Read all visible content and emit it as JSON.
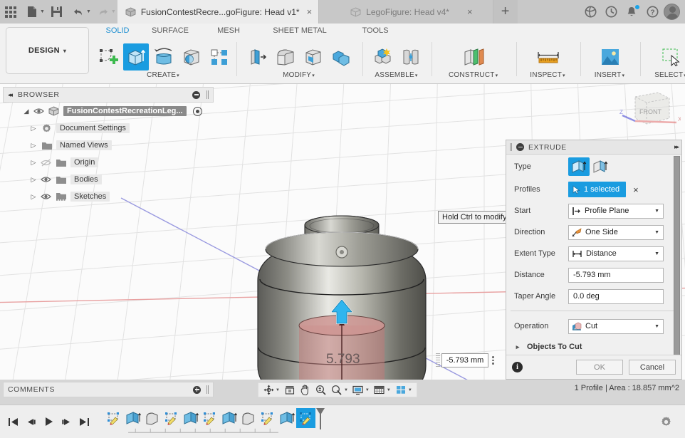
{
  "titlebar": {
    "icons": [
      "apps-grid-icon",
      "new-document-icon",
      "save-icon",
      "undo-icon",
      "redo-icon"
    ],
    "tabs": [
      {
        "label": "FusionContestRecre...goFigure: Head v1*",
        "active": true,
        "close": "×"
      },
      {
        "label": "LegoFigure: Head v4*",
        "active": false,
        "close": "×"
      }
    ],
    "new_tab": "+",
    "right_icons": [
      "globe-icon",
      "job-status-icon",
      "notifications-bell-icon",
      "help-icon",
      "account-avatar"
    ]
  },
  "ribbon": {
    "design_label": "DESIGN",
    "design_caret": "▾",
    "tabs": [
      {
        "label": "SOLID",
        "selected": true
      },
      {
        "label": "SURFACE",
        "selected": false
      },
      {
        "label": "MESH",
        "selected": false
      },
      {
        "label": "SHEET METAL",
        "selected": false
      },
      {
        "label": "TOOLS",
        "selected": false
      }
    ],
    "groups": [
      {
        "caption": "CREATE",
        "caret": "▾",
        "buttons": [
          "create-sketch-icon",
          "extrude-icon",
          "revolve-icon",
          "hole-icon",
          "rectangular-pattern-icon"
        ]
      },
      {
        "caption": "MODIFY",
        "caret": "▾",
        "buttons": [
          "press-pull-icon",
          "fillet-icon",
          "shell-icon",
          "combine-icon"
        ]
      },
      {
        "caption": "ASSEMBLE",
        "caret": "▾",
        "buttons": [
          "new-component-icon",
          "joint-icon"
        ]
      },
      {
        "caption": "CONSTRUCT",
        "caret": "▾",
        "buttons": [
          "offset-plane-icon"
        ]
      },
      {
        "caption": "INSPECT",
        "caret": "▾",
        "buttons": [
          "measure-icon"
        ]
      },
      {
        "caption": "INSERT",
        "caret": "▾",
        "buttons": [
          "insert-image-icon"
        ]
      },
      {
        "caption": "SELECT",
        "caret": "▾",
        "buttons": [
          "select-window-icon"
        ]
      }
    ]
  },
  "browser": {
    "title": "BROWSER",
    "collapse_icon": "◂◂",
    "items": [
      {
        "label": "FusionContestRecreationLeg...",
        "indent": 0,
        "tri": "◢",
        "eye": true,
        "icon": "component-cube-icon",
        "selected": true,
        "activate": true
      },
      {
        "label": "Document Settings",
        "indent": 1,
        "tri": "▷",
        "eye": false,
        "icon": "gear-icon",
        "selected": false
      },
      {
        "label": "Named Views",
        "indent": 1,
        "tri": "▷",
        "eye": false,
        "icon": "folder-icon",
        "selected": false
      },
      {
        "label": "Origin",
        "indent": 1,
        "tri": "▷",
        "eye": true,
        "eye_off": true,
        "icon": "folder-icon",
        "selected": false
      },
      {
        "label": "Bodies",
        "indent": 1,
        "tri": "▷",
        "eye": true,
        "icon": "folder-icon",
        "selected": false
      },
      {
        "label": "Sketches",
        "indent": 1,
        "tri": "▷",
        "eye": true,
        "icon": "folder-sketch-icon",
        "selected": false
      }
    ]
  },
  "canvas": {
    "tooltip": "Hold Ctrl to modify selection",
    "dimension_value": "-5.793 mm",
    "model_dimension_label": "5.793",
    "viewcube_face": "FRONT",
    "axis_labels": {
      "x": "X",
      "z": "Z"
    }
  },
  "extrude": {
    "title": "EXTRUDE",
    "expand_icon": "▸▸",
    "rows": {
      "type_label": "Type",
      "type_options": [
        "profile-extrude-icon",
        "surface-extrude-icon"
      ],
      "profiles_label": "Profiles",
      "profiles_value": "1 selected",
      "profiles_clear": "×",
      "start_label": "Start",
      "start_value": "Profile Plane",
      "direction_label": "Direction",
      "direction_value": "One Side",
      "extent_label": "Extent Type",
      "extent_value": "Distance",
      "distance_label": "Distance",
      "distance_value": "-5.793 mm",
      "taper_label": "Taper Angle",
      "taper_value": "0.0 deg",
      "operation_label": "Operation",
      "operation_value": "Cut",
      "objects_label": "Objects To Cut",
      "objects_tri": "▸"
    },
    "footer": {
      "info": "i",
      "ok": "OK",
      "cancel": "Cancel"
    }
  },
  "comments": {
    "title": "COMMENTS"
  },
  "navbar": {
    "buttons": [
      "orbit-icon",
      "fit-icon",
      "pan-icon",
      "zoom-icon",
      "look-at-icon",
      "display-settings-icon",
      "grid-snap-icon",
      "viewports-icon"
    ]
  },
  "status": {
    "text": "1 Profile | Area : 18.857 mm^2"
  },
  "timeline": {
    "nav": [
      "jump-to-start-icon",
      "step-back-icon",
      "play-icon",
      "step-forward-icon",
      "jump-to-end-icon"
    ],
    "features": [
      {
        "icon": "sketch-feature-icon",
        "selected": false
      },
      {
        "icon": "extrude-feature-icon",
        "selected": false
      },
      {
        "icon": "fillet-feature-icon",
        "selected": false
      },
      {
        "icon": "sketch-feature-icon",
        "selected": false
      },
      {
        "icon": "extrude-feature-icon",
        "selected": false
      },
      {
        "icon": "sketch-feature-icon",
        "selected": false
      },
      {
        "icon": "extrude-feature-icon",
        "selected": false
      },
      {
        "icon": "fillet-feature-icon",
        "selected": false
      },
      {
        "icon": "sketch-feature-icon",
        "selected": false
      },
      {
        "icon": "extrude-feature-icon",
        "selected": false
      },
      {
        "icon": "sketch-feature-icon",
        "selected": true
      }
    ],
    "settings_icon": "gear-icon"
  },
  "colors": {
    "accent": "#1a9ce0",
    "titlebar": "#c8c8c8",
    "ribbon": "#f1f1f1",
    "canvas": "#fbfbfb",
    "selection_blue": "#2b30c8",
    "highlight_red": "#e02020"
  }
}
